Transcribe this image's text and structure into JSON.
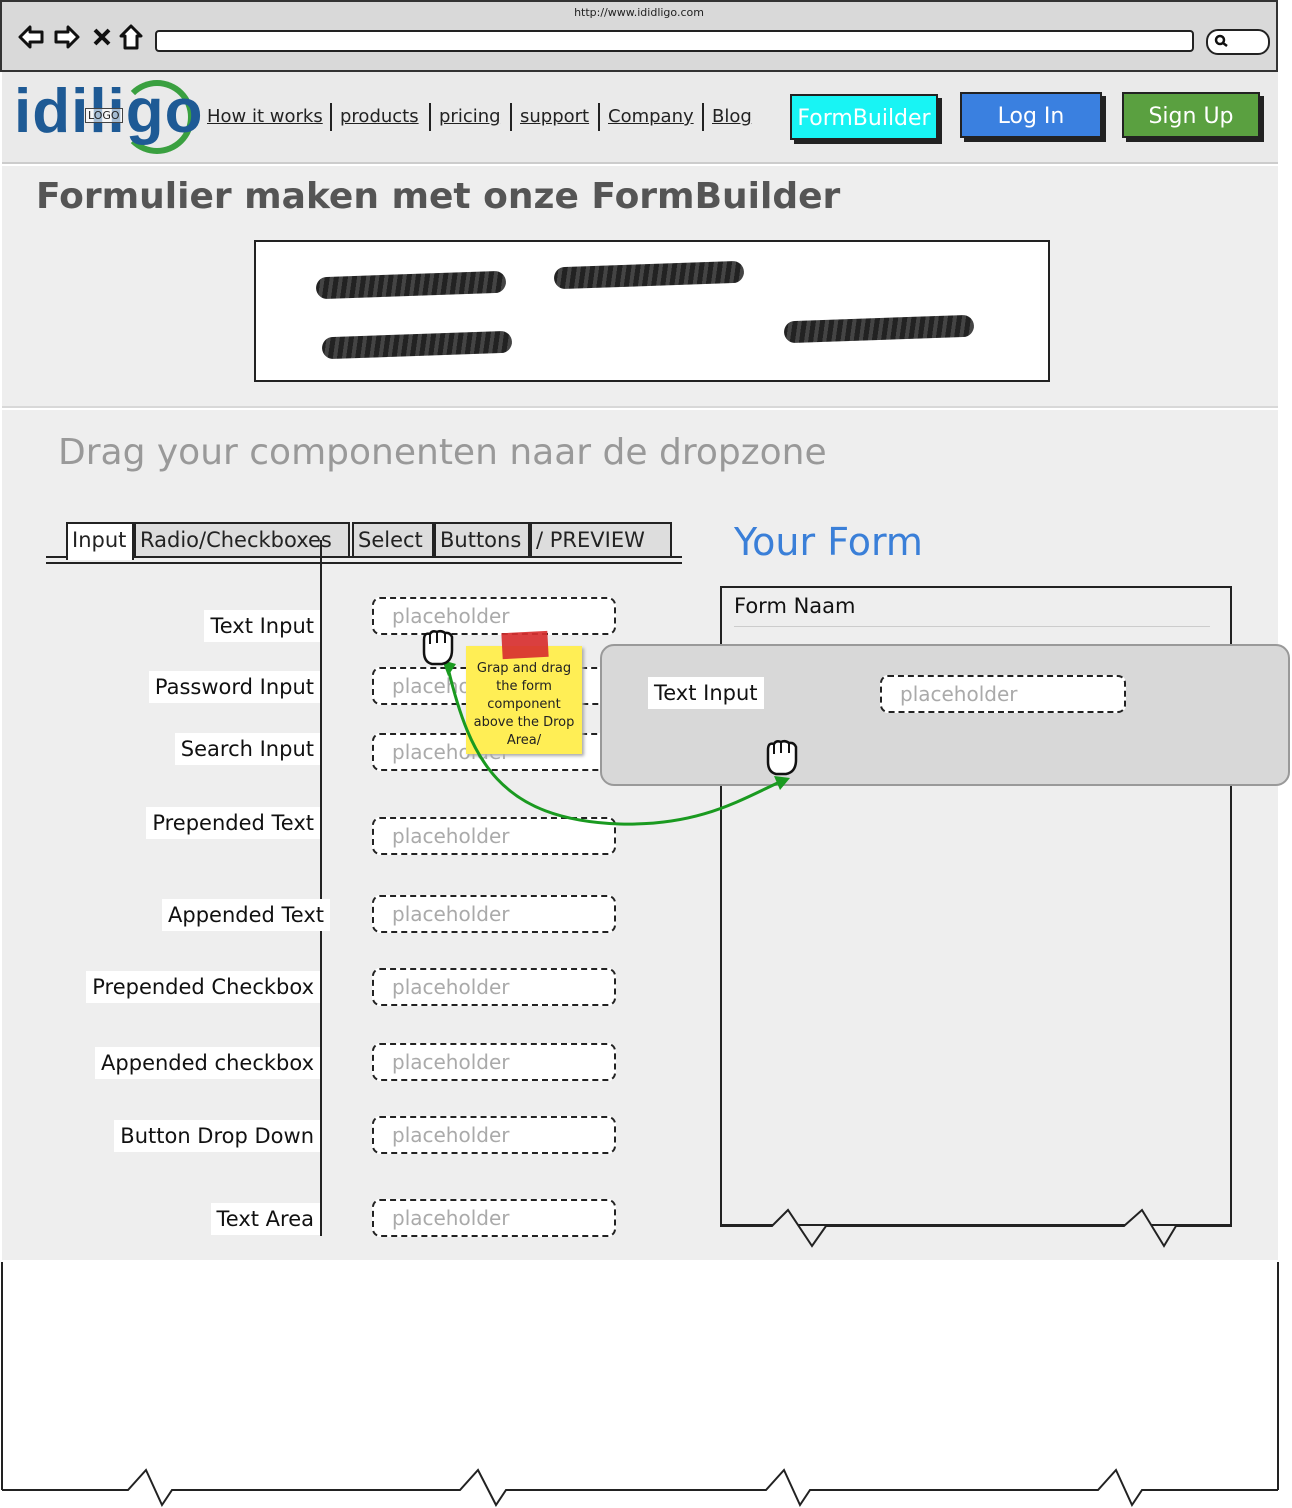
{
  "browser": {
    "url": "http://www.ididligo.com"
  },
  "header": {
    "logo_text": "idiligo",
    "logo_placeholder": "LOGO",
    "nav": [
      "How it works",
      "products",
      "pricing",
      "support",
      "Company",
      "Blog"
    ],
    "buttons": {
      "formbuilder": "FormBuilder",
      "login": "Log In",
      "signup": "Sign Up"
    }
  },
  "page": {
    "title": "Formulier maken  met onze FormBuilder",
    "subtitle": "Drag your componenten naar de dropzone"
  },
  "tabs": [
    "Input",
    "Radio/Checkboxes",
    "Select",
    "Buttons",
    "/ PREVIEW"
  ],
  "components": [
    {
      "label": "Text Input",
      "placeholder": "placeholder"
    },
    {
      "label": "Password Input",
      "placeholder": "placeholder"
    },
    {
      "label": "Search Input",
      "placeholder": "placeholder"
    },
    {
      "label": "Prepended Text",
      "placeholder": "placeholder"
    },
    {
      "label": "Appended Text",
      "placeholder": "placeholder"
    },
    {
      "label": "Prepended Checkbox",
      "placeholder": "placeholder"
    },
    {
      "label": "Appended checkbox",
      "placeholder": "placeholder"
    },
    {
      "label": "Button Drop Down",
      "placeholder": "placeholder"
    },
    {
      "label": "Text Area",
      "placeholder": "placeholder"
    }
  ],
  "form": {
    "heading": "Your Form",
    "name": "Form Naam",
    "dragged_label": "Text Input",
    "dragged_placeholder": "placeholder"
  },
  "sticky_note": "Grap and drag the form component above the Drop Area/",
  "colors": {
    "formbuilder_btn": "#18f4f4",
    "login_btn": "#3a80e0",
    "signup_btn": "#5aa040",
    "your_form_heading": "#3a7fd8",
    "drag_arrow": "#1a9a20"
  }
}
